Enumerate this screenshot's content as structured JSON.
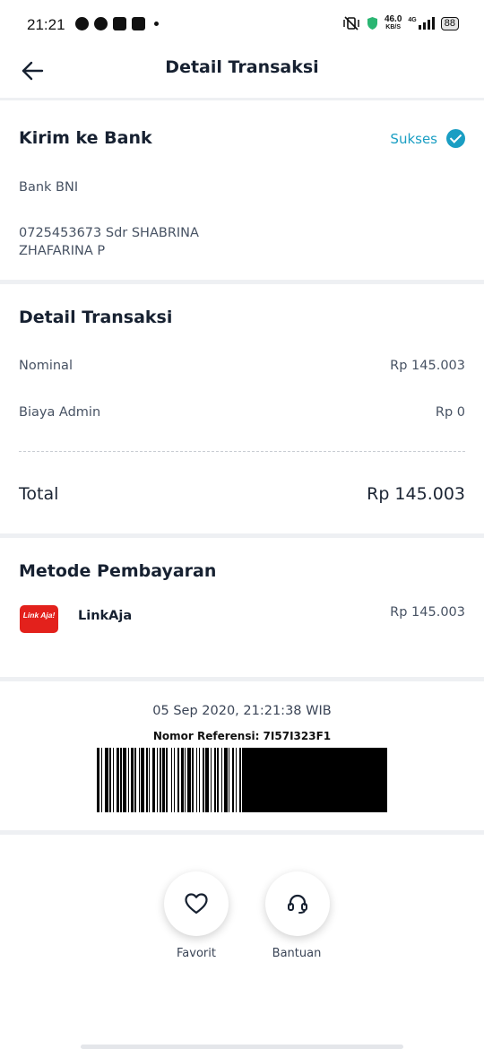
{
  "status_bar": {
    "time": "21:21",
    "net_speed": "46.0",
    "net_unit": "KB/S",
    "network": "4G",
    "battery": "88"
  },
  "header": {
    "title": "Detail Transaksi"
  },
  "transfer": {
    "title": "Kirim ke Bank",
    "status": "Sukses",
    "bank": "Bank BNI",
    "account_line1": "0725453673 Sdr SHABRINA",
    "account_line2": "ZHAFARINA P"
  },
  "detail": {
    "title": "Detail Transaksi",
    "nominal_label": "Nominal",
    "nominal_value": "Rp 145.003",
    "admin_label": "Biaya Admin",
    "admin_value": "Rp 0",
    "total_label": "Total",
    "total_value": "Rp 145.003"
  },
  "payment": {
    "title": "Metode Pembayaran",
    "method_logo_text": "Link Aja!",
    "method_name": "LinkAja",
    "method_amount": "Rp 145.003"
  },
  "receipt": {
    "datetime": "05 Sep 2020, 21:21:38 WIB",
    "reference": "Nomor Referensi: 7I57I323F1"
  },
  "actions": {
    "favorite_label": "Favorit",
    "help_label": "Bantuan"
  },
  "colors": {
    "accent": "#1a9ec3",
    "linkaja_red": "#e3211c"
  }
}
